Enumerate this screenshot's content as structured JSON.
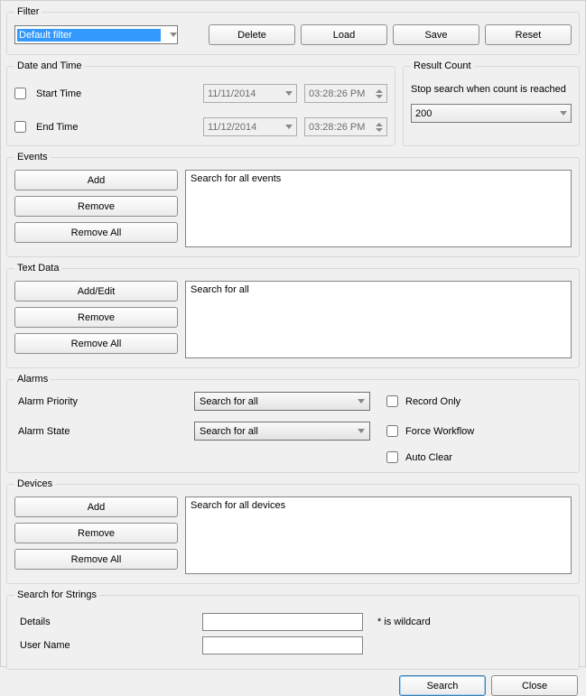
{
  "filter": {
    "legend": "Filter",
    "selected": "Default filter",
    "buttons": {
      "delete": "Delete",
      "load": "Load",
      "save": "Save",
      "reset": "Reset"
    }
  },
  "datetime": {
    "legend": "Date and Time",
    "start": {
      "label": "Start Time",
      "date": "11/11/2014",
      "time": "03:28:26 PM"
    },
    "end": {
      "label": "End Time",
      "date": "11/12/2014",
      "time": "03:28:26 PM"
    }
  },
  "resultcount": {
    "legend": "Result Count",
    "label": "Stop search when count is reached",
    "value": "200"
  },
  "events": {
    "legend": "Events",
    "add": "Add",
    "remove": "Remove",
    "remove_all": "Remove All",
    "list_text": "Search for all events"
  },
  "textdata": {
    "legend": "Text Data",
    "add_edit": "Add/Edit",
    "remove": "Remove",
    "remove_all": "Remove All",
    "list_text": "Search for all"
  },
  "alarms": {
    "legend": "Alarms",
    "priority_label": "Alarm Priority",
    "state_label": "Alarm State",
    "priority_value": "Search for all",
    "state_value": "Search for all",
    "record_only": "Record Only",
    "force_workflow": "Force Workflow",
    "auto_clear": "Auto Clear"
  },
  "devices": {
    "legend": "Devices",
    "add": "Add",
    "remove": "Remove",
    "remove_all": "Remove All",
    "list_text": "Search for all devices"
  },
  "strings": {
    "legend": "Search for Strings",
    "details_label": "Details",
    "username_label": "User Name",
    "wildcard": "* is wildcard"
  },
  "footer": {
    "search": "Search",
    "close": "Close"
  }
}
